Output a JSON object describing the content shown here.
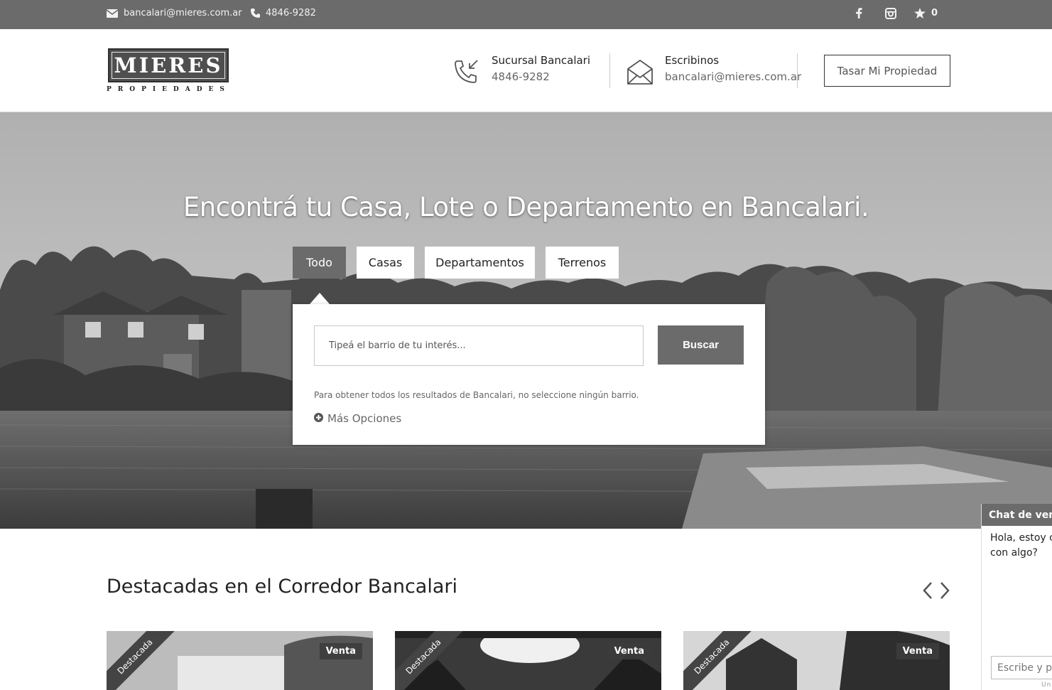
{
  "topbar": {
    "email": "bancalari@mieres.com.ar",
    "phone": "4846-9282",
    "favorites_count": "0",
    "icons": [
      "envelope-icon",
      "phone-icon",
      "facebook-icon",
      "instagram-icon",
      "star-icon"
    ]
  },
  "header": {
    "logo_word": "MIERES",
    "logo_sub": "PROPIEDADES",
    "branch_label": "Sucursal Bancalari",
    "branch_phone": "4846-9282",
    "write_label": "Escribinos",
    "write_email": "bancalari@mieres.com.ar",
    "cta": "Tasar Mi Propiedad"
  },
  "hero": {
    "title": "Encontrá tu Casa, Lote o Departamento en Bancalari.",
    "tabs": [
      {
        "label": "Todo",
        "active": true
      },
      {
        "label": "Casas",
        "active": false
      },
      {
        "label": "Departamentos",
        "active": false
      },
      {
        "label": "Terrenos",
        "active": false
      }
    ],
    "search_placeholder": "Tipeá el barrio de tu interés...",
    "search_button": "Buscar",
    "hint": "Para obtener todos los resultados de Bancalari, no seleccione ningún barrio.",
    "more_options": "Más Opciones"
  },
  "featured": {
    "title": "Destacadas en el Corredor Bancalari",
    "cards": [
      {
        "ribbon": "Destacada",
        "badge": "Venta"
      },
      {
        "ribbon": "Destacada",
        "badge": "Venta"
      },
      {
        "ribbon": "Destacada",
        "badge": "Venta"
      }
    ]
  },
  "chat": {
    "header": "Chat de ventas",
    "message_line1": "Hola, estoy c",
    "message_line2": "con algo?",
    "input_placeholder": "Escribe y pr",
    "footer": "Un"
  }
}
